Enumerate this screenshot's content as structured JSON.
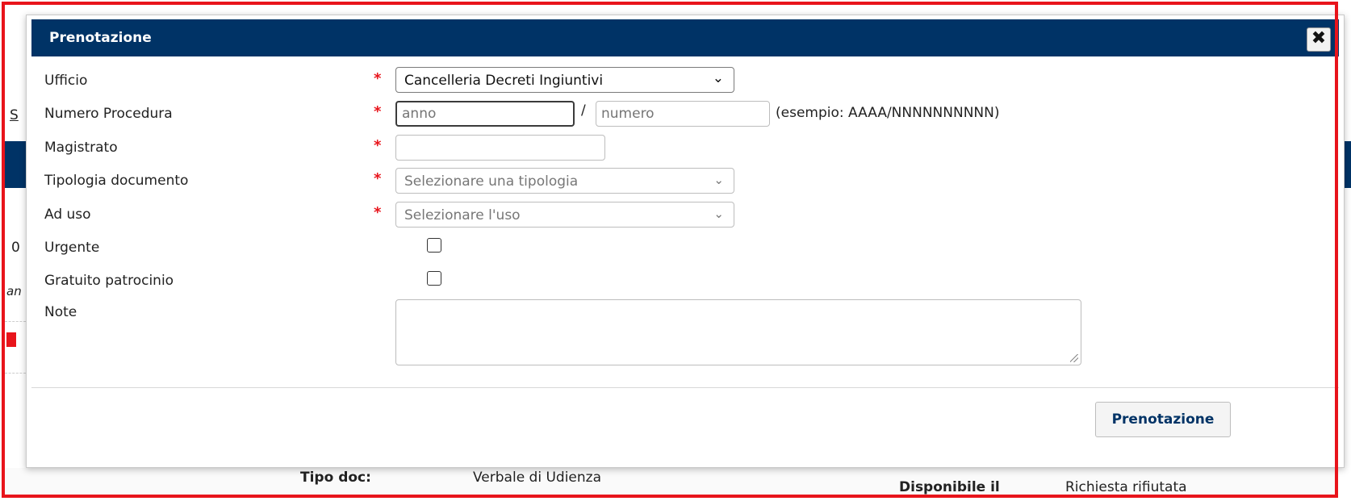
{
  "dialog": {
    "title": "Prenotazione",
    "close_glyph": "✖",
    "required_mark": "*",
    "fields": {
      "ufficio": {
        "label": "Ufficio",
        "value": "Cancelleria Decreti Ingiuntivi"
      },
      "numero_procedura": {
        "label": "Numero Procedura",
        "anno_placeholder": "anno",
        "separator": "/",
        "numero_placeholder": "numero",
        "hint": "(esempio: AAAA/NNNNNNNNNN)"
      },
      "magistrato": {
        "label": "Magistrato",
        "value": ""
      },
      "tipologia_documento": {
        "label": "Tipologia documento",
        "placeholder": "Selezionare una tipologia"
      },
      "ad_uso": {
        "label": "Ad uso",
        "placeholder": "Selezionare l'uso"
      },
      "urgente": {
        "label": "Urgente",
        "checked": false
      },
      "gratuito_patrocinio": {
        "label": "Gratuito patrocinio",
        "checked": false
      },
      "note": {
        "label": "Note",
        "value": ""
      }
    },
    "submit_label": "Prenotazione"
  },
  "background": {
    "left_fragments": [
      "S",
      "0",
      "an"
    ],
    "footer": {
      "tipo_doc_label": "Tipo doc:",
      "tipo_doc_value": "Verbale di Udienza",
      "disponibile_label": "Disponibile il",
      "status": "Richiesta rifiutata"
    }
  },
  "colors": {
    "header_bg": "#003366",
    "required": "#e8141b",
    "highlight_frame": "#e8141b",
    "button_text": "#003366"
  },
  "icons": {
    "close": "close-icon",
    "dropdown": "chevron-down-icon",
    "resize": "resize-grip-icon"
  }
}
